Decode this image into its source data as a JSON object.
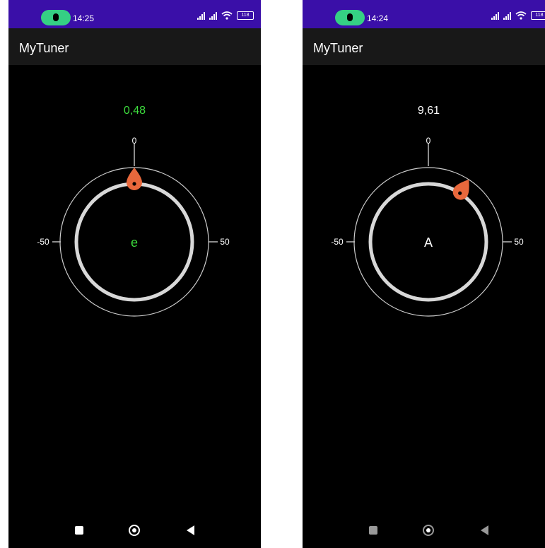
{
  "colors": {
    "status_bar": "#3a0fa8",
    "app_bar": "#181818",
    "background": "#000000",
    "in_tune": "#3ddc3d",
    "needle": "#e8683c",
    "text": "#ffffff"
  },
  "screens": [
    {
      "status": {
        "time": "14:25",
        "battery": "118"
      },
      "app_title": "MyTuner",
      "tuner": {
        "cents_value": "0,48",
        "note": "e",
        "in_tune": true,
        "scale_top": "0",
        "scale_left": "-50",
        "scale_right": "50",
        "needle_angle_deg": 0
      }
    },
    {
      "status": {
        "time": "14:24",
        "battery": "118"
      },
      "app_title": "MyTuner",
      "tuner": {
        "cents_value": "9,61",
        "note": "A",
        "in_tune": false,
        "scale_top": "0",
        "scale_left": "-50",
        "scale_right": "50",
        "needle_angle_deg": 33
      }
    }
  ],
  "icons": {
    "mic": "mic-icon",
    "signal": "signal-icon",
    "wifi": "wifi-icon",
    "battery": "battery-icon",
    "recents": "square-icon",
    "home": "circle-icon",
    "back": "triangle-back-icon"
  }
}
